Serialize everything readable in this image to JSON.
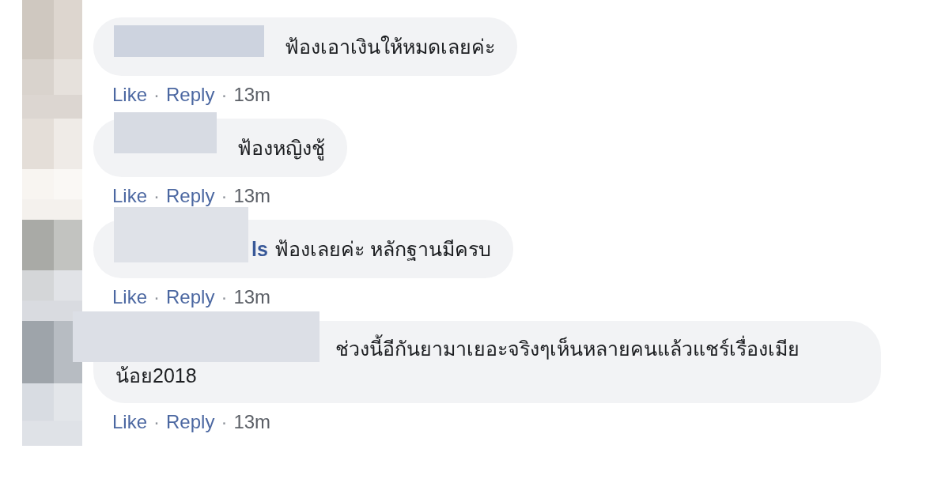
{
  "comments": [
    {
      "text": "ฟ้องเอาเงินให้หมดเลยค่ะ",
      "actions": [
        "Like",
        "Reply"
      ],
      "separator": "·",
      "time": "13m"
    },
    {
      "text": "ฟ้องหญิงชู้",
      "actions": [
        "Like",
        "Reply"
      ],
      "separator": "·",
      "time": "13m"
    },
    {
      "name_visible": "ls",
      "text": "ฟ้องเลยค่ะ หลักฐานมีครบ",
      "actions": [
        "Like",
        "Reply"
      ],
      "separator": "·",
      "time": "13m"
    },
    {
      "text": "ช่วงนี้อีกันยามาเยอะจริงๆเห็นหลายคนแล้วแชร์เรื่องเมียน้อย2018",
      "actions": [
        "Like",
        "Reply"
      ],
      "separator": "·",
      "time": "13m"
    }
  ]
}
